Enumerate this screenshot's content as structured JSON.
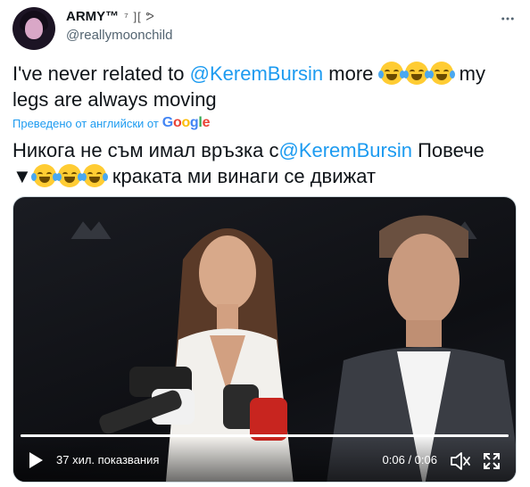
{
  "author": {
    "display_name": "ARMY™",
    "name_suffix": "⁷ ][ ᕗ",
    "handle": "@reallymoonchild"
  },
  "tweet": {
    "text_before": "I've never related to ",
    "mention": "@KeremBursin",
    "text_middle": " more ",
    "text_after": " my legs are always moving"
  },
  "translation": {
    "label": "Преведено от английски от",
    "provider": [
      "G",
      "o",
      "o",
      "g",
      "l",
      "e"
    ],
    "text_before": "Никога не съм имал връзка с",
    "mention": "@KeremBursin",
    "text_after": " Повече",
    "marker": "▼",
    "text_end": " краката ми винаги се движат"
  },
  "video": {
    "views": "37 хил. показвания",
    "time": "0:06 / 0:06",
    "progress": 1.0
  },
  "colors": {
    "accent": "#1d9bf0",
    "text": "#0f1419",
    "secondary": "#536471"
  },
  "icons": {
    "more": "more-icon",
    "play": "play-icon",
    "mute": "volume-muted-icon",
    "fullscreen": "fullscreen-icon"
  }
}
